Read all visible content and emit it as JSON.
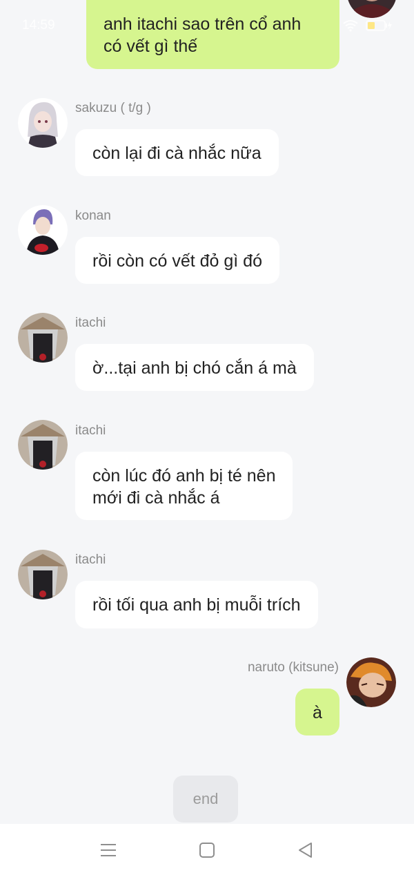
{
  "status_bar": {
    "time": "14:59",
    "battery": "40"
  },
  "top_message": {
    "text_line1": "anh itachi sao trên cổ anh",
    "text_line2": "có vết gì thế"
  },
  "messages": [
    {
      "sender": "sakuzu ( t/g )",
      "lines": [
        "còn lại đi cà nhắc nữa"
      ]
    },
    {
      "sender": "konan",
      "lines": [
        "rồi còn có vết đỏ gì đó"
      ]
    },
    {
      "sender": "itachi",
      "lines": [
        "ờ...tại anh bị chó cắn á mà"
      ]
    },
    {
      "sender": "itachi",
      "lines": [
        "còn lúc đó anh bị té nên",
        "mới đi cà nhắc á"
      ]
    },
    {
      "sender": "itachi",
      "lines": [
        "rồi tối qua anh bị muỗi trích"
      ]
    }
  ],
  "self_message": {
    "sender": "naruto (kitsune)",
    "text": "à"
  },
  "end_button": {
    "label": "end"
  },
  "nav_bar": {
    "icons": [
      "menu-icon",
      "home-square-icon",
      "back-triangle-icon"
    ]
  },
  "colors": {
    "background": "#f5f6f8",
    "sent_bubble": "#d6f58f",
    "received_bubble": "#ffffff",
    "name_text": "#8a8a8a"
  }
}
